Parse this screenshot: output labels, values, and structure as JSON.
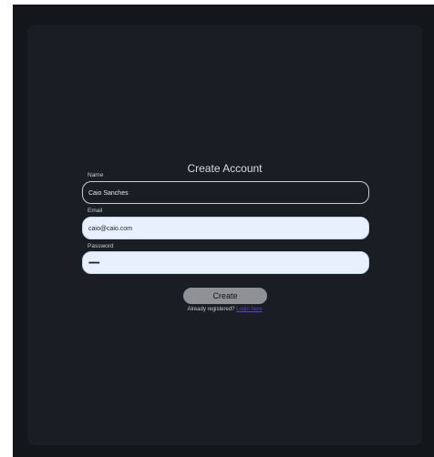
{
  "form": {
    "title": "Create Account",
    "fields": [
      {
        "label": "Name",
        "value": "Caio Sanches"
      },
      {
        "label": "Email",
        "value": "caio@caio.com"
      },
      {
        "label": "Password",
        "value": "••••••••"
      }
    ],
    "submit_label": "Create",
    "footer": {
      "text": "Already registered?",
      "link_label": "Login here"
    }
  },
  "colors": {
    "background": "#13161b",
    "card": "#1a1e24",
    "input_autofill": "#e8f0fe",
    "button": "#8f9195",
    "link": "#5b3fd6"
  }
}
